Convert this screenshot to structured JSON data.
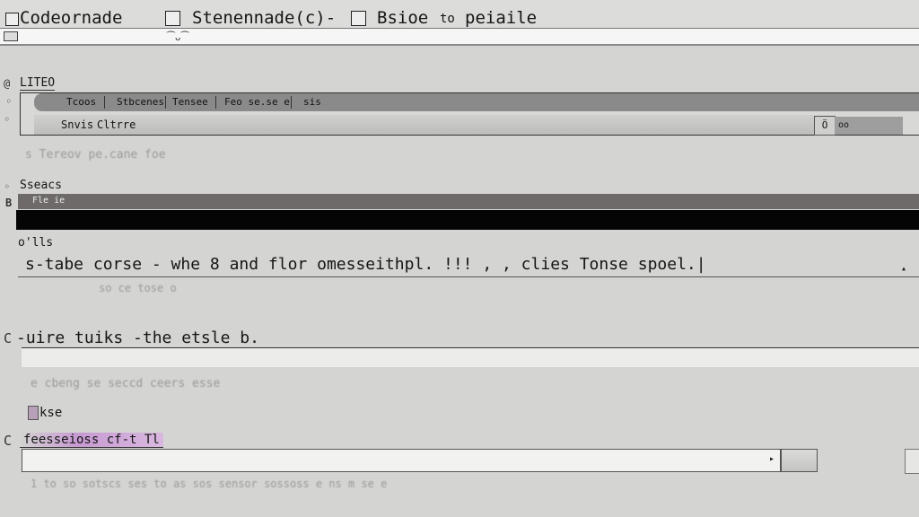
{
  "window": {
    "app_title": "Codeornade",
    "doc_title": "Stenennade(c)-",
    "panel_title": "Bsioe",
    "arrow_text": "to",
    "panel_title2": "peiaile",
    "toolbar_hint": "⁀ᴗ⁀"
  },
  "section1": {
    "edge_mark": "@",
    "label": "LITEO",
    "tabs": [
      "Tcoos",
      "Stbcenes",
      "Tensee",
      "Feo se.se e",
      "sis"
    ],
    "sub_label": "Snvis",
    "sub_value": "Cltrre",
    "small_button": "Ö",
    "field_value": "oo",
    "faint_text": "s Tereov pe.cane foe"
  },
  "section2": {
    "label": "Sseacs",
    "bar_text": "Fle ie",
    "note": "o'lls",
    "text_line": "s-tabe corse - whe 8 and flor omesseithpl. !!! , , clies Tonse spoel.|",
    "faint_text": "so ce tose o"
  },
  "section3": {
    "label": "-uire tuiks -the etsle b.",
    "edge_mark": "C",
    "faint_text": "e cbeng se seccd ceers esse"
  },
  "section4": {
    "checkbox_label": "kse",
    "label": "feesseioss cf-t Tl",
    "edge_mark": "C",
    "dropdown_arrow": "▸",
    "faint_text": "1 to so sotscs ses to as sos sensor sossoss e ns m se e"
  },
  "colors": {
    "background": "#d4d4d2",
    "tab_strip": "#8a8a8a",
    "gray_bar": "#6d6a69",
    "black_bar": "#050505",
    "input": "#ececea",
    "highlight": "#c79ad2"
  }
}
